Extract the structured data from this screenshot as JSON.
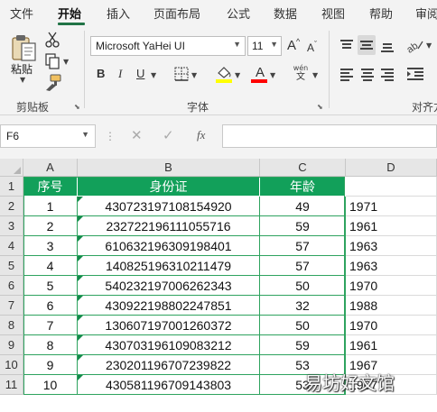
{
  "menu": {
    "tabs": [
      {
        "label": "文件",
        "active": false
      },
      {
        "label": "开始",
        "active": true
      },
      {
        "label": "插入",
        "active": false
      },
      {
        "label": "页面布局",
        "active": false
      },
      {
        "label": "公式",
        "active": false
      },
      {
        "label": "数据",
        "active": false
      },
      {
        "label": "视图",
        "active": false
      },
      {
        "label": "帮助",
        "active": false
      },
      {
        "label": "审阅",
        "active": false
      }
    ]
  },
  "ribbon": {
    "clipboard": {
      "paste_label": "粘贴",
      "group_label": "剪贴板"
    },
    "font": {
      "font_name": "Microsoft YaHei UI",
      "font_size": "11",
      "grow_label": "A",
      "shrink_label": "A",
      "bold_label": "B",
      "italic_label": "I",
      "underline_label": "U",
      "font_color_label": "A",
      "fill_color": "#ffff00",
      "font_color": "#ff0000",
      "phonetic_top": "wén",
      "phonetic_bottom": "文",
      "group_label": "字体"
    },
    "alignment": {
      "group_label": "对齐方"
    }
  },
  "formula_bar": {
    "name_box": "F6",
    "fx_label": "fx",
    "formula": ""
  },
  "sheet": {
    "columns": [
      "A",
      "B",
      "C",
      "D"
    ],
    "header_fill": "#12a05a",
    "rows": [
      {
        "row": "1",
        "a": "序号",
        "b": "身份证",
        "c": "年龄",
        "d": ""
      },
      {
        "row": "2",
        "a": "1",
        "b": "430723197108154920",
        "c": "49",
        "d": "1971"
      },
      {
        "row": "3",
        "a": "2",
        "b": "232722196111055716",
        "c": "59",
        "d": "1961"
      },
      {
        "row": "4",
        "a": "3",
        "b": "610632196309198401",
        "c": "57",
        "d": "1963"
      },
      {
        "row": "5",
        "a": "4",
        "b": "140825196310211479",
        "c": "57",
        "d": "1963"
      },
      {
        "row": "6",
        "a": "5",
        "b": "540232197006262343",
        "c": "50",
        "d": "1970"
      },
      {
        "row": "7",
        "a": "6",
        "b": "430922198802247851",
        "c": "32",
        "d": "1988"
      },
      {
        "row": "8",
        "a": "7",
        "b": "130607197001260372",
        "c": "50",
        "d": "1970"
      },
      {
        "row": "9",
        "a": "8",
        "b": "430703196109083212",
        "c": "59",
        "d": "1961"
      },
      {
        "row": "10",
        "a": "9",
        "b": "230201196707239822",
        "c": "53",
        "d": "1967"
      },
      {
        "row": "11",
        "a": "10",
        "b": "430581196709143803",
        "c": "53",
        "d": "1967"
      }
    ]
  },
  "watermark": "易坊好文馆"
}
